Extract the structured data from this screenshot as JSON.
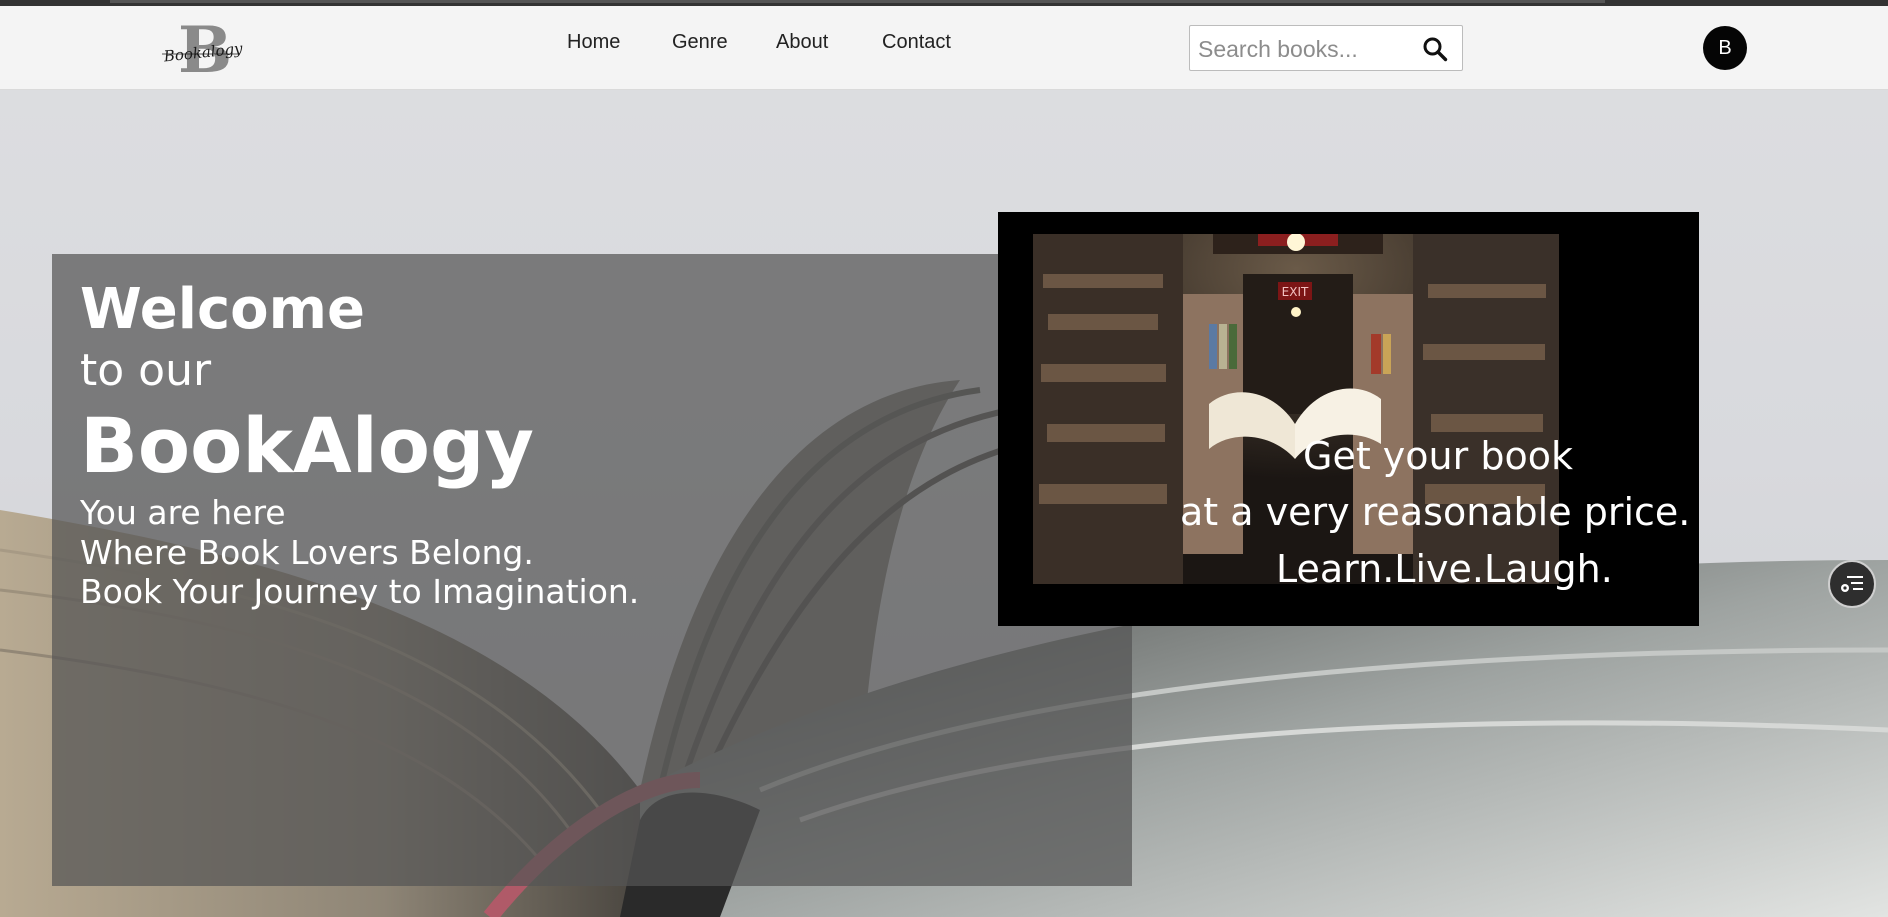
{
  "nav": {
    "links": [
      "Home",
      "Genre",
      "About",
      "Contact"
    ],
    "search_placeholder": "Search books...",
    "avatar_initial": "B"
  },
  "logo": {
    "letter": "B",
    "script": "Bookalogy"
  },
  "hero": {
    "welcome": "Welcome",
    "to_our": "to our",
    "brand": "BookAlogy",
    "taglines": [
      "You are here",
      "Where Book Lovers Belong.",
      "Book Your Journey to Imagination."
    ]
  },
  "promo": {
    "lines": [
      "Get your book",
      "at a very reasonable price.",
      "Learn.Live.Laugh."
    ],
    "exit_sign": "EXIT"
  },
  "icons": {
    "search": "search-icon",
    "menu": "list-settings-icon",
    "logo": "book-logo-icon"
  },
  "colors": {
    "navbar_bg": "#f4f4f4",
    "overlay": "#545454",
    "promo_bg": "#000000",
    "avatar_bg": "#050505"
  }
}
